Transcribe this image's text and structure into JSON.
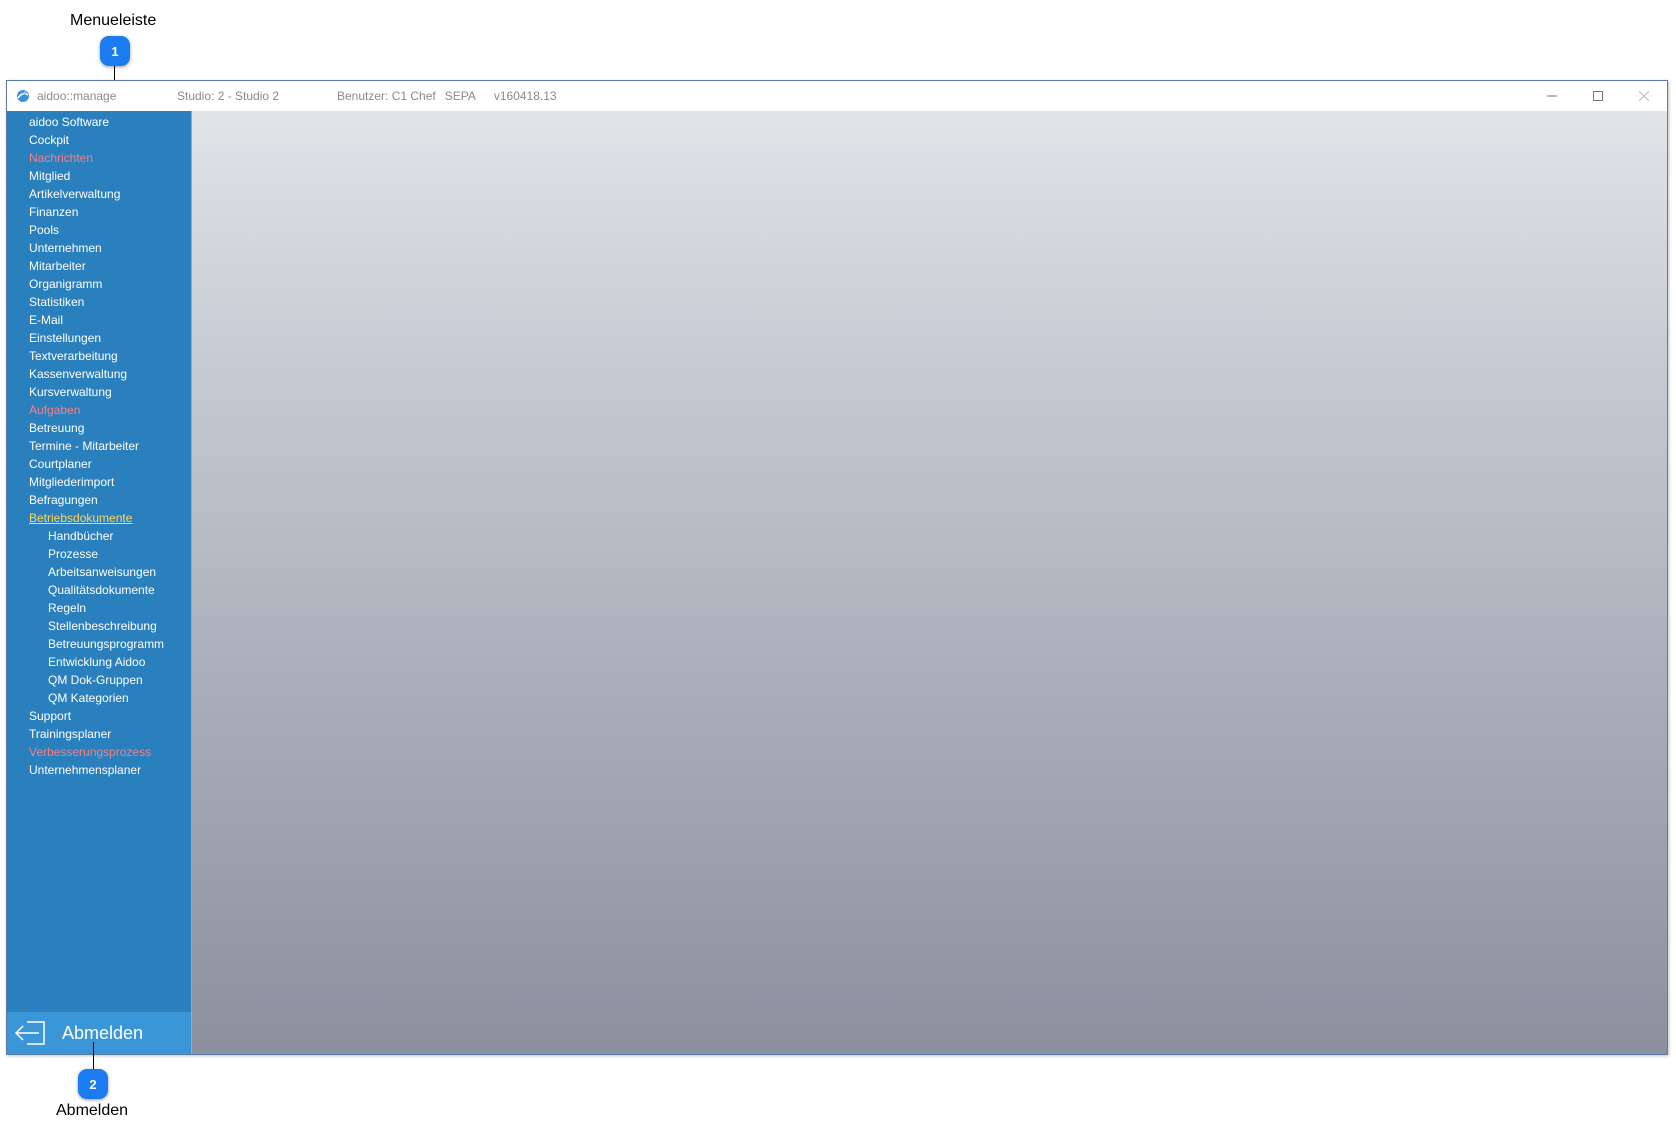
{
  "callouts": [
    {
      "number": "1",
      "label": "Menueleiste"
    },
    {
      "number": "2",
      "label": "Abmelden"
    }
  ],
  "titlebar": {
    "app_name": "aidoo::manage",
    "studio": "Studio: 2 - Studio 2",
    "user": "Benutzer: C1 Chef",
    "mode": "SEPA",
    "version": "v160418.13",
    "minimize_icon": "minimize-icon",
    "maximize_icon": "maximize-icon",
    "close_icon": "close-icon"
  },
  "colors": {
    "sidebar": "#2a7fbd",
    "sidebar_border": "#e3a22c",
    "logout_bg": "#3a96d6",
    "badge": "#1a7cf0",
    "menu_red": "#f0808a",
    "menu_active": "#ffd75a"
  },
  "sidebar": {
    "items": [
      {
        "label": "aidoo Software",
        "style": "normal",
        "level": 0
      },
      {
        "label": "Cockpit",
        "style": "normal",
        "level": 0
      },
      {
        "label": "Nachrichten",
        "style": "red",
        "level": 0
      },
      {
        "label": "Mitglied",
        "style": "normal",
        "level": 0
      },
      {
        "label": "Artikelverwaltung",
        "style": "normal",
        "level": 0
      },
      {
        "label": "Finanzen",
        "style": "normal",
        "level": 0
      },
      {
        "label": "Pools",
        "style": "normal",
        "level": 0
      },
      {
        "label": "Unternehmen",
        "style": "normal",
        "level": 0
      },
      {
        "label": "Mitarbeiter",
        "style": "normal",
        "level": 0
      },
      {
        "label": "Organigramm",
        "style": "normal",
        "level": 0
      },
      {
        "label": "Statistiken",
        "style": "normal",
        "level": 0
      },
      {
        "label": "E-Mail",
        "style": "normal",
        "level": 0
      },
      {
        "label": "Einstellungen",
        "style": "normal",
        "level": 0
      },
      {
        "label": "Textverarbeitung",
        "style": "normal",
        "level": 0
      },
      {
        "label": "Kassenverwaltung",
        "style": "normal",
        "level": 0
      },
      {
        "label": "Kursverwaltung",
        "style": "normal",
        "level": 0
      },
      {
        "label": "Aufgaben",
        "style": "red",
        "level": 0
      },
      {
        "label": "Betreuung",
        "style": "normal",
        "level": 0
      },
      {
        "label": "Termine - Mitarbeiter",
        "style": "normal",
        "level": 0
      },
      {
        "label": "Courtplaner",
        "style": "normal",
        "level": 0
      },
      {
        "label": "Mitgliederimport",
        "style": "normal",
        "level": 0
      },
      {
        "label": "Befragungen",
        "style": "normal",
        "level": 0
      },
      {
        "label": "Betriebsdokumente",
        "style": "active",
        "level": 0
      },
      {
        "label": "Handbücher",
        "style": "normal",
        "level": 1
      },
      {
        "label": "Prozesse",
        "style": "normal",
        "level": 1
      },
      {
        "label": "Arbeitsanweisungen",
        "style": "normal",
        "level": 1
      },
      {
        "label": "Qualitätsdokumente",
        "style": "normal",
        "level": 1
      },
      {
        "label": "Regeln",
        "style": "normal",
        "level": 1
      },
      {
        "label": "Stellenbeschreibung",
        "style": "normal",
        "level": 1
      },
      {
        "label": "Betreuungsprogramm",
        "style": "normal",
        "level": 1
      },
      {
        "label": "Entwicklung Aidoo",
        "style": "normal",
        "level": 1
      },
      {
        "label": "QM Dok-Gruppen",
        "style": "normal",
        "level": 1
      },
      {
        "label": "QM Kategorien",
        "style": "normal",
        "level": 1
      },
      {
        "label": "Support",
        "style": "normal",
        "level": 0
      },
      {
        "label": "Trainingsplaner",
        "style": "normal",
        "level": 0
      },
      {
        "label": "Verbesserungsprozess",
        "style": "red",
        "level": 0
      },
      {
        "label": "Unternehmensplaner",
        "style": "normal",
        "level": 0
      }
    ],
    "logout_label": "Abmelden",
    "logout_icon": "logout-arrow-icon"
  }
}
